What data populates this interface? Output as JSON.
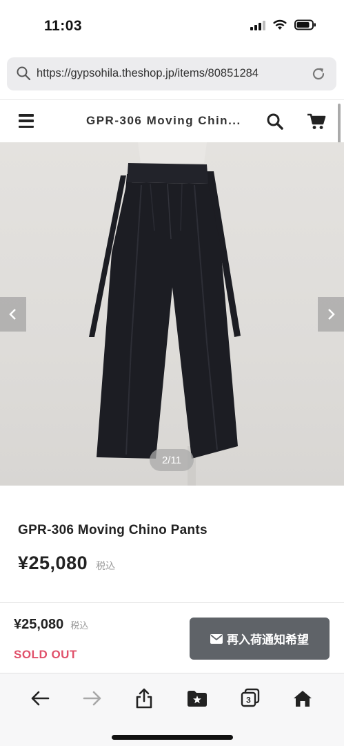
{
  "status_bar": {
    "time": "11:03"
  },
  "url_bar": {
    "url": "https://gypsohila.theshop.jp/items/80851284"
  },
  "site_header": {
    "title": "GPR-306 Moving Chin..."
  },
  "gallery": {
    "counter": "2/11"
  },
  "product": {
    "name": "GPR-306 Moving Chino Pants",
    "price": "¥25,080",
    "tax_label": "税込"
  },
  "purchase_bar": {
    "price": "¥25,080",
    "tax_label": "税込",
    "status": "SOLD OUT",
    "restock_label": "再入荷通知希望"
  },
  "browser_toolbar": {
    "tab_count": "3"
  },
  "colors": {
    "sold_out": "#e0506a",
    "restock_button": "#5f6368",
    "pants": "#1c1d23"
  }
}
